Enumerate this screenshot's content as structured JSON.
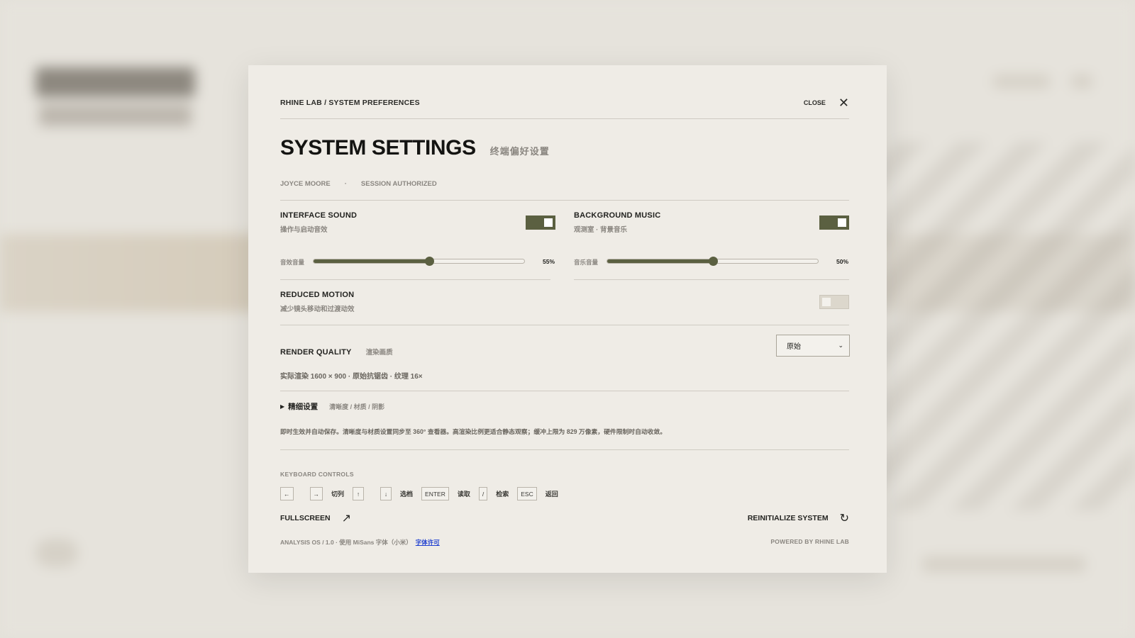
{
  "breadcrumb": "RHINE LAB / SYSTEM PREFERENCES",
  "close_label": "CLOSE",
  "title": "SYSTEM SETTINGS",
  "title_cn": "终端偏好设置",
  "session": {
    "user": "JOYCE MOORE",
    "separator": "·",
    "status": "SESSION AUTHORIZED"
  },
  "interface_sound": {
    "label": "INTERFACE SOUND",
    "sub": "操作与启动音效",
    "enabled": true,
    "slider_label": "音效音量",
    "volume": 55,
    "volume_text": "55%"
  },
  "background_music": {
    "label": "BACKGROUND MUSIC",
    "sub": "观测室 · 背景音乐",
    "enabled": true,
    "slider_label": "音乐音量",
    "volume": 50,
    "volume_text": "50%"
  },
  "reduced_motion": {
    "label": "REDUCED MOTION",
    "sub": "减少镜头移动和过渡动效",
    "enabled": false
  },
  "render_quality": {
    "label": "RENDER QUALITY",
    "label_cn": "渲染画质",
    "selected": "原始",
    "meta": "实际渲染 1600 × 900 · 原始抗锯齿 · 纹理 16×"
  },
  "advanced": {
    "caret": "▶",
    "title": "精细设置",
    "sub": "清晰度 / 材质 / 阴影"
  },
  "note": "即时生效并自动保存。清晰度与材质设置同步至 360° 查看器。高渲染比例更适合静态观察；缓冲上限为 829 万像素，硬件限制时自动收敛。",
  "keyboard": {
    "title": "KEYBOARD CONTROLS",
    "keys": [
      "←",
      "→",
      "↑",
      "↓",
      "ENTER",
      "/",
      "ESC"
    ],
    "descs": {
      "switch": "切列",
      "select": "选档",
      "read": "读取",
      "search": "检索",
      "back": "返回"
    }
  },
  "actions": {
    "fullscreen": "FULLSCREEN",
    "fullscreen_icon": "↗",
    "reinit": "REINITIALIZE SYSTEM",
    "reinit_icon": "↻"
  },
  "footer": {
    "left": "ANALYSIS OS / 1.0 · 使用 MiSans 字体（小米）",
    "license": "字体许可",
    "right": "POWERED BY RHINE LAB"
  },
  "colors": {
    "accent": "#5b6041",
    "panel": "#efece6",
    "muted": "#8a8680",
    "link": "#1f3fd0"
  }
}
